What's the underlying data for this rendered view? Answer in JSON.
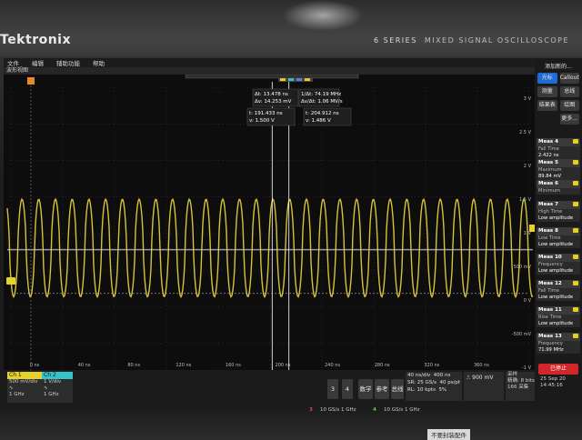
{
  "bezel": {
    "brand": "Tektronix",
    "series_label": "6 SERIES",
    "series_sub": "MIXED SIGNAL OSCILLOSCOPE"
  },
  "menu": [
    "文件",
    "编辑",
    "辅助功能",
    "帮助"
  ],
  "window_title": "波形视图",
  "right_panel": {
    "title": "添加新的...",
    "buttons": [
      "光标",
      "Callout",
      "测量",
      "总线",
      "结果表",
      "绘图",
      "更多..."
    ]
  },
  "y_labels": [
    "3 V",
    "2.5 V",
    "2 V",
    "1.5 V",
    "1 V",
    "500 mV",
    "0 V",
    "-500 mV",
    "-1 V"
  ],
  "x_labels": [
    "0 ns",
    "40 ns",
    "80 ns",
    "120 ns",
    "160 ns",
    "200 ns",
    "240 ns",
    "280 ns",
    "320 ns",
    "360 ns"
  ],
  "cursor_readout": {
    "dt": "Δt: 13.478 ns",
    "dv": "Δv: 14.253 mV",
    "inv_dt": "1/Δt: 74.19 MHz",
    "dv_dt": "Δv/Δt: 1.06 MV/s",
    "c1_t": "t: 191.433 ns",
    "c1_v": "v: 1.500 V",
    "c2_t": "t: 204.912 ns",
    "c2_v": "v: 1.486 V"
  },
  "measurements": [
    {
      "title": "Meas 4",
      "label": "Fall Time",
      "value": "2.422 ns"
    },
    {
      "title": "Meas 5",
      "label": "Maximum",
      "value": "89.84 mV"
    },
    {
      "title": "Meas 6",
      "label": "Minimum",
      "value": ""
    },
    {
      "title": "Meas 7",
      "label": "High Time",
      "value": "",
      "extra": "Low amplitude"
    },
    {
      "title": "Meas 8",
      "label": "Low Time",
      "value": "",
      "extra": "Low amplitude"
    },
    {
      "title": "Meas 10",
      "label": "Frequency",
      "value": "",
      "extra": "Low amplitude"
    },
    {
      "title": "Meas 12",
      "label": "Fall Time",
      "value": "",
      "extra": "Low amplitude"
    },
    {
      "title": "Meas 11",
      "label": "Rise Time",
      "value": "",
      "extra": "Low amplitude"
    },
    {
      "title": "Meas 13",
      "label": "Frequency",
      "value": "71.99 MHz"
    }
  ],
  "channels": {
    "ch1": {
      "name": "Ch 1",
      "scale": "500 mV/div",
      "bw": "1 GHz"
    },
    "ch2": {
      "name": "Ch 2",
      "scale": "1 V/div",
      "bw": "1 GHz"
    }
  },
  "bottom_buttons": [
    "3",
    "4",
    "数学",
    "参考",
    "总线"
  ],
  "horizontal": {
    "row1a": "40 ns/div",
    "row1b": "400 ns",
    "row2a": "SR: 25 GS/s",
    "row2b": "40 ps/pt",
    "row3a": "RL: 10 kpts",
    "row3b": "5%"
  },
  "trigger": {
    "value": "900 mV"
  },
  "acquisition": {
    "line1": "采样",
    "line2": "精确: 8 bits",
    "line3": "166 采集"
  },
  "run_stop": "已停止",
  "clock": {
    "date": "25 Sep 20",
    "time": "14:45:16"
  },
  "lower_bezel": {
    "ch3": "3",
    "ch3_text": "10 GS/s 1 GHz",
    "ch4": "4",
    "ch4_text": "10 GS/s 1 GHz",
    "sticker": "不要封装配件"
  },
  "colors": {
    "ch1": "#e6d22a",
    "ch2": "#35c3c9",
    "cursor": "#ffffff",
    "accent": "#1e6bd6",
    "stop": "#d1262a"
  },
  "waveform": {
    "frequency_mhz": 74.19,
    "high_v": 1.5,
    "low_v": 0.05,
    "time_per_div_ns": 40,
    "volts_per_div": 0.5
  }
}
